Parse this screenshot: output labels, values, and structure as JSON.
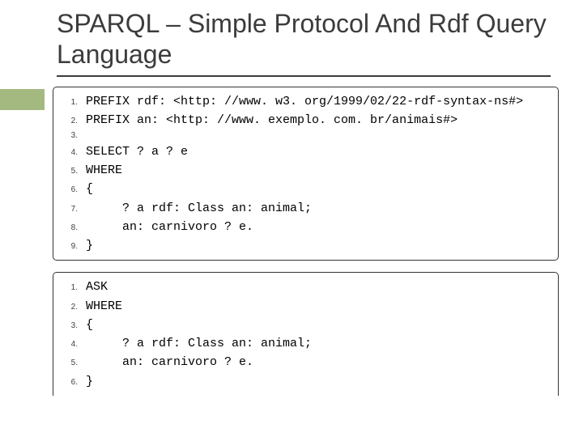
{
  "title": "SPARQL – Simple Protocol And Rdf Query Language",
  "block1": {
    "lines": [
      {
        "n": "1.",
        "t": "PREFIX rdf: <http: //www. w3. org/1999/02/22-rdf-syntax-ns#>"
      },
      {
        "n": "2.",
        "t": "PREFIX an: <http: //www. exemplo. com. br/animais#>"
      },
      {
        "n": "3.",
        "t": ""
      },
      {
        "n": "4.",
        "t": "SELECT ? a ? e"
      },
      {
        "n": "5.",
        "t": "WHERE"
      },
      {
        "n": "6.",
        "t": "{"
      },
      {
        "n": "7.",
        "t": "     ? a rdf: Class an: animal;"
      },
      {
        "n": "8.",
        "t": "     an: carnivoro ? e."
      },
      {
        "n": "9.",
        "t": "}"
      }
    ]
  },
  "block2": {
    "lines": [
      {
        "n": "1.",
        "t": "ASK"
      },
      {
        "n": "2.",
        "t": "WHERE"
      },
      {
        "n": "3.",
        "t": "{"
      },
      {
        "n": "4.",
        "t": "     ? a rdf: Class an: animal;"
      },
      {
        "n": "5.",
        "t": "     an: carnivoro ? e."
      },
      {
        "n": "6.",
        "t": "}"
      }
    ]
  }
}
